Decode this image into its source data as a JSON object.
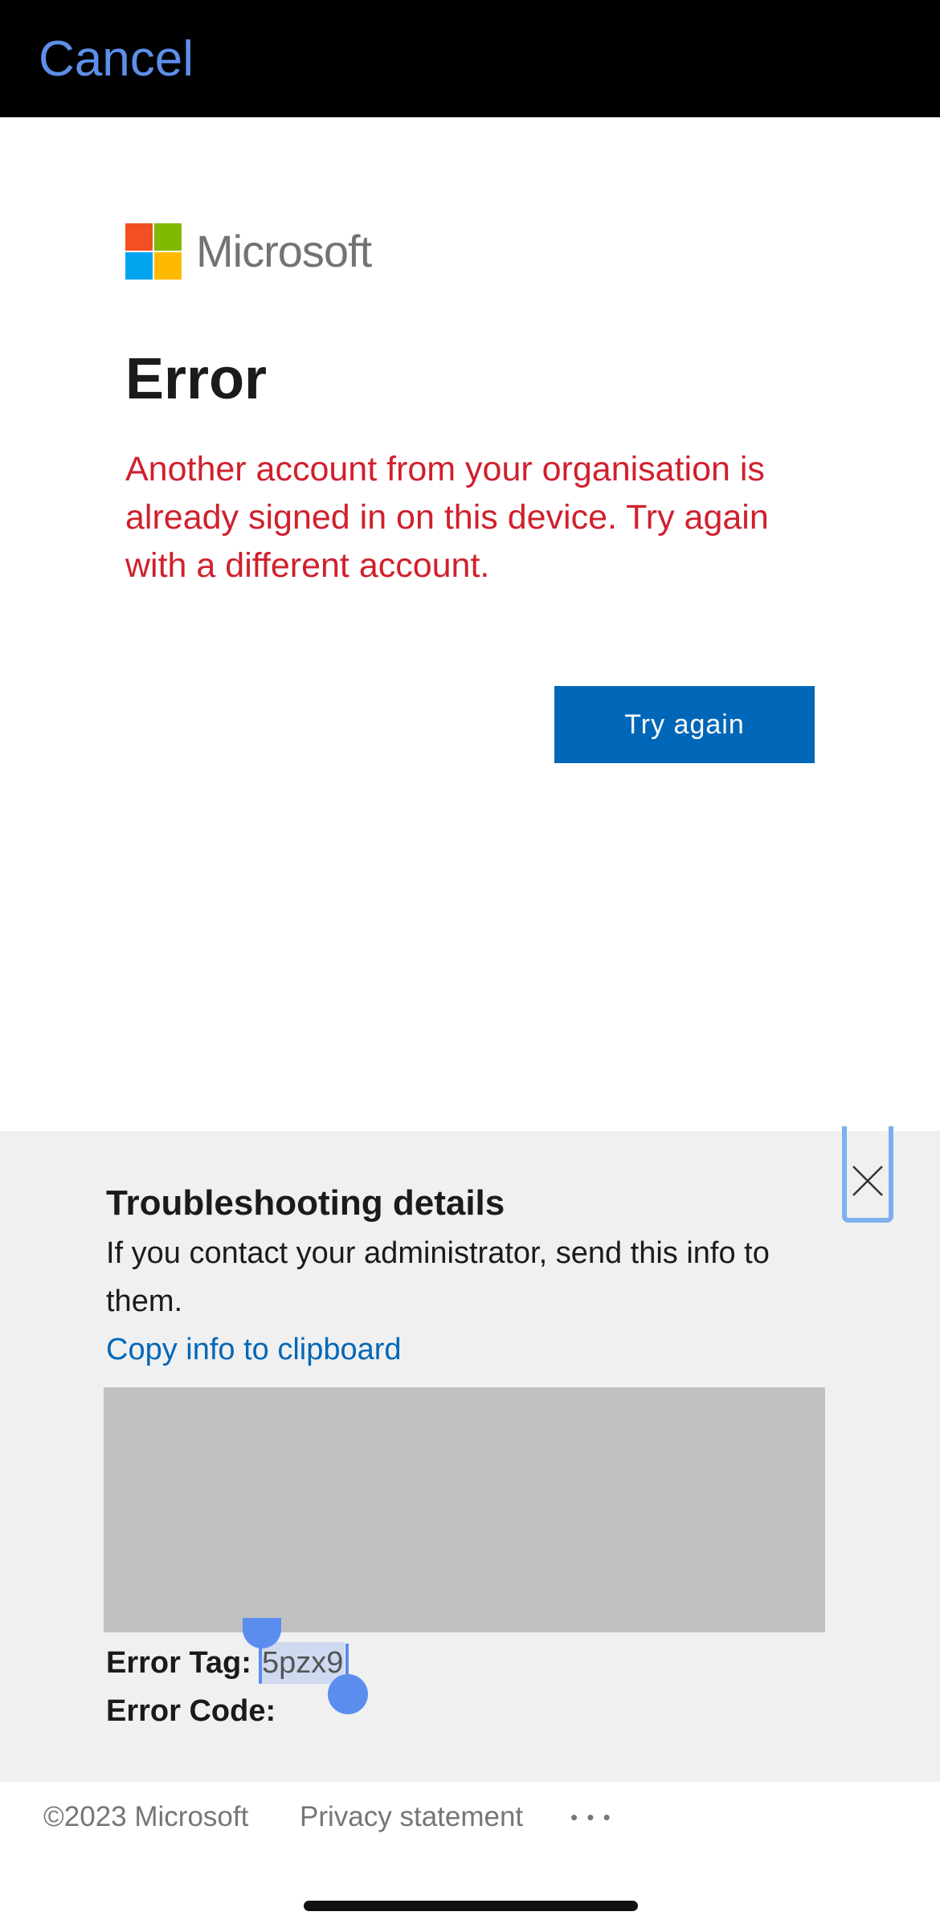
{
  "topbar": {
    "cancel_label": "Cancel"
  },
  "brand": {
    "name": "Microsoft",
    "logo_colors": [
      "#f25022",
      "#7fba00",
      "#00a4ef",
      "#ffb900"
    ]
  },
  "main": {
    "title": "Error",
    "message": "Another account from your organisation is already signed in on this device. Try again with a different account.",
    "try_again_label": "Try again"
  },
  "troubleshooting": {
    "title": "Troubleshooting details",
    "description": "If you contact your administrator, send this info to them.",
    "copy_link": "Copy info to clipboard",
    "error_tag_label": "Error Tag:",
    "error_tag_value": "5pzx9",
    "error_code_label": "Error Code:",
    "close_icon": "close-icon"
  },
  "footer": {
    "copyright": "©2023 Microsoft",
    "privacy": "Privacy statement",
    "more": "• • •"
  },
  "colors": {
    "accent": "#0067b8",
    "error": "#d0202d",
    "cancel": "#5d8fe9"
  }
}
